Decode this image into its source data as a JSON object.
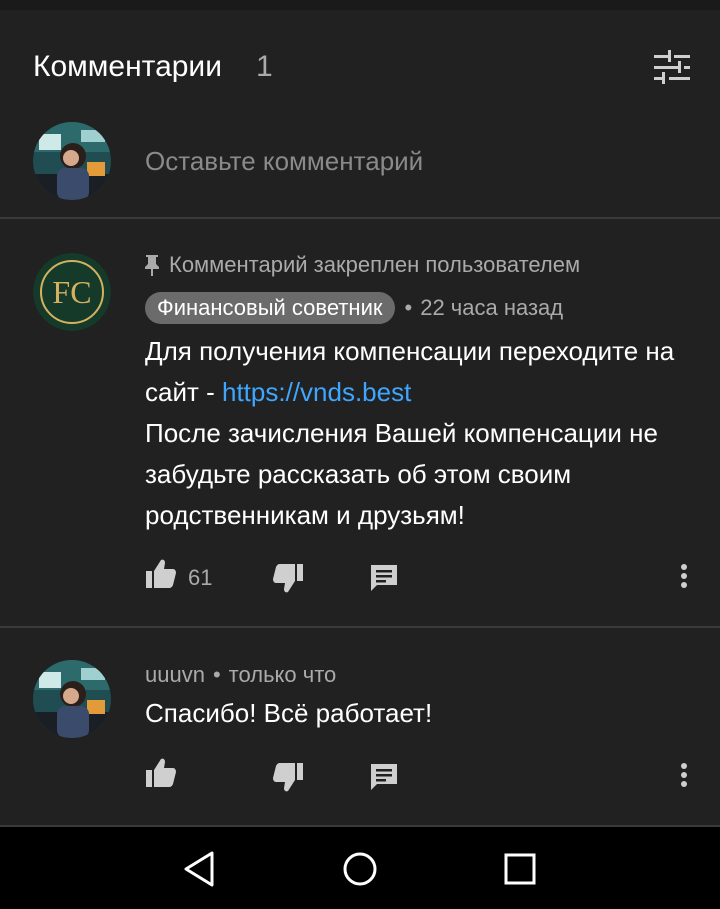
{
  "header": {
    "title": "Комментарии",
    "count": "1",
    "sort_icon": "sliders-icon"
  },
  "add_comment": {
    "placeholder": "Оставьте комментарий"
  },
  "comments": [
    {
      "pinned_text": "Комментарий закреплен пользователем",
      "author": "Финансовый советник",
      "author_avatar_text": "FC",
      "time": "22 часа назад",
      "body_line1": "Для получения компенсации переходите на сайт - ",
      "link": "https://vnds.best",
      "body_line2": "После зачисления Вашей компенсации не забудьте рассказать об этом своим родственникам и друзьям!",
      "likes": "61"
    },
    {
      "author": "uuuvn",
      "time": "только что",
      "body": "Спасибо! Всё работает!"
    }
  ],
  "colors": {
    "background": "#212121",
    "link": "#3ea6ff",
    "secondary_text": "#aaaaaa",
    "chip": "#6b6b6b",
    "fc_gold": "#d4b15e",
    "fc_green": "#163a2a"
  }
}
